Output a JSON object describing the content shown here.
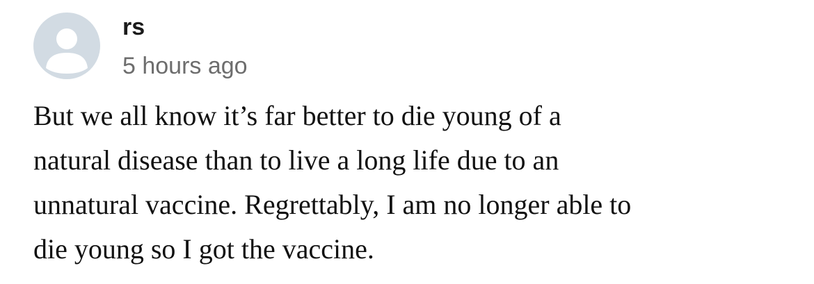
{
  "comment": {
    "avatar_icon": "user-placeholder-icon",
    "author": "rs",
    "timestamp": "5 hours ago",
    "body_lines": [
      "But we all know it’s far better to die young of a",
      "natural disease than to live a long life due to an",
      "unnatural vaccine. Regrettably, I am no longer able to",
      "die young so I got the vaccine."
    ]
  },
  "colors": {
    "avatar_background": "#d2dbe3",
    "avatar_figure": "#ffffff",
    "author_text": "#1b1b1b",
    "timestamp_text": "#6d6d6d",
    "body_text": "#111111"
  }
}
